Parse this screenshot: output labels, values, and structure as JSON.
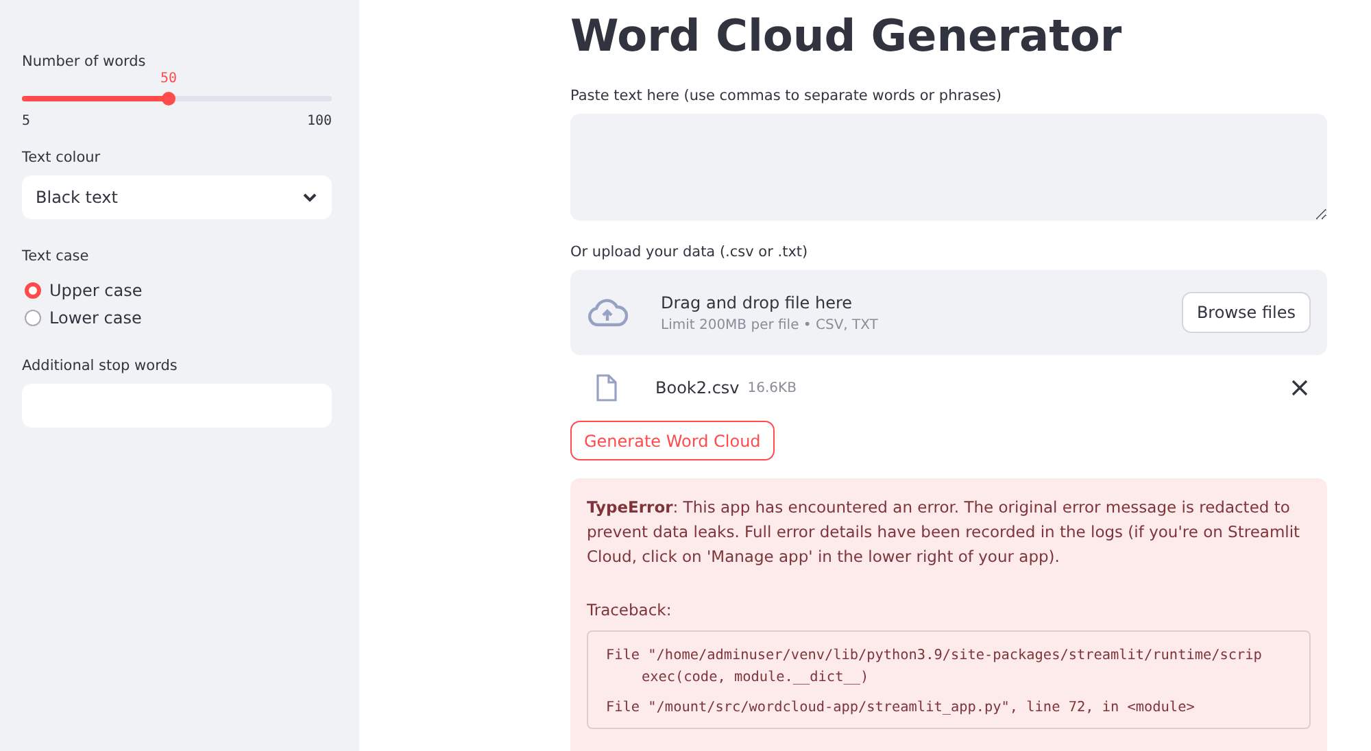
{
  "sidebar": {
    "slider": {
      "label": "Number of words",
      "value": "50",
      "min": "5",
      "max": "100",
      "level": 0.4737
    },
    "select": {
      "label": "Text colour",
      "value": "Black text"
    },
    "radio": {
      "label": "Text case",
      "options": [
        {
          "label": "Upper case",
          "selected": true
        },
        {
          "label": "Lower case",
          "selected": false
        }
      ]
    },
    "stop_words": {
      "label": "Additional stop words"
    }
  },
  "main": {
    "title": "Word Cloud Generator",
    "text_area": {
      "label": "Paste text here (use commas to separate words or phrases)"
    },
    "uploader": {
      "label": "Or upload your data (.csv or .txt)",
      "drop_text": "Drag and drop file here",
      "limit": "Limit 200MB per file • CSV, TXT",
      "button": "Browse files"
    },
    "file": {
      "name": "Book2.csv",
      "size": "16.6KB"
    },
    "generate_button": "Generate Word Cloud",
    "error": {
      "message": "**TypeError**: This app has encountered an error. The original error message is redacted to prevent data leaks. Full error details have been recorded in the logs (if you're on Streamlit Cloud, click on 'Manage app' in the lower right of your app).",
      "traceback_label": "Traceback:",
      "traceback": [
        {
          "file": "File \"/home/adminuser/venv/lib/python3.9/site-packages/streamlit/runtime/scrip",
          "code": "exec(code, module.__dict__)"
        },
        {
          "file": "File \"/mount/src/wordcloud-app/streamlit_app.py\", line 72, in <module>"
        }
      ]
    }
  }
}
